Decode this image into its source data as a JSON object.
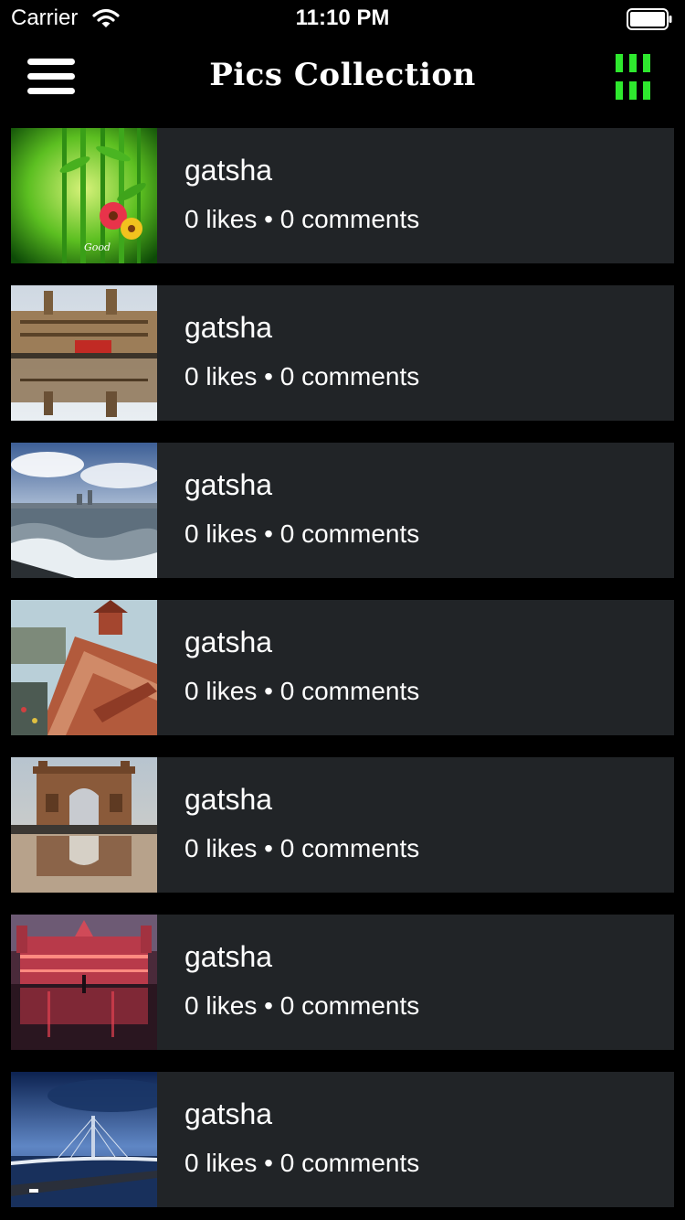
{
  "status_bar": {
    "carrier": "Carrier",
    "time": "11:10 PM",
    "icons": [
      "wifi-icon",
      "battery-icon"
    ]
  },
  "nav": {
    "title": "Pics Collection",
    "left_icon": "hamburger-menu-icon",
    "right_icon": "grid-view-icon",
    "accent_color": "#2ee82e"
  },
  "theme": {
    "background": "#000000",
    "card_background": "#212427",
    "text": "#ffffff"
  },
  "posts": [
    {
      "author": "gatsha",
      "likes": "0 likes",
      "separator": "•",
      "comments": "0 comments",
      "image": "bamboo-flowers-photo"
    },
    {
      "author": "gatsha",
      "likes": "0 likes",
      "separator": "•",
      "comments": "0 comments",
      "image": "heritage-building-reflection-photo"
    },
    {
      "author": "gatsha",
      "likes": "0 likes",
      "separator": "•",
      "comments": "0 comments",
      "image": "seafront-waves-photo"
    },
    {
      "author": "gatsha",
      "likes": "0 likes",
      "separator": "•",
      "comments": "0 comments",
      "image": "market-rooftops-photo"
    },
    {
      "author": "gatsha",
      "likes": "0 likes",
      "separator": "•",
      "comments": "0 comments",
      "image": "gateway-monument-photo"
    },
    {
      "author": "gatsha",
      "likes": "0 likes",
      "separator": "•",
      "comments": "0 comments",
      "image": "illuminated-station-photo"
    },
    {
      "author": "gatsha",
      "likes": "0 likes",
      "separator": "•",
      "comments": "0 comments",
      "image": "sea-link-bridge-photo"
    }
  ]
}
